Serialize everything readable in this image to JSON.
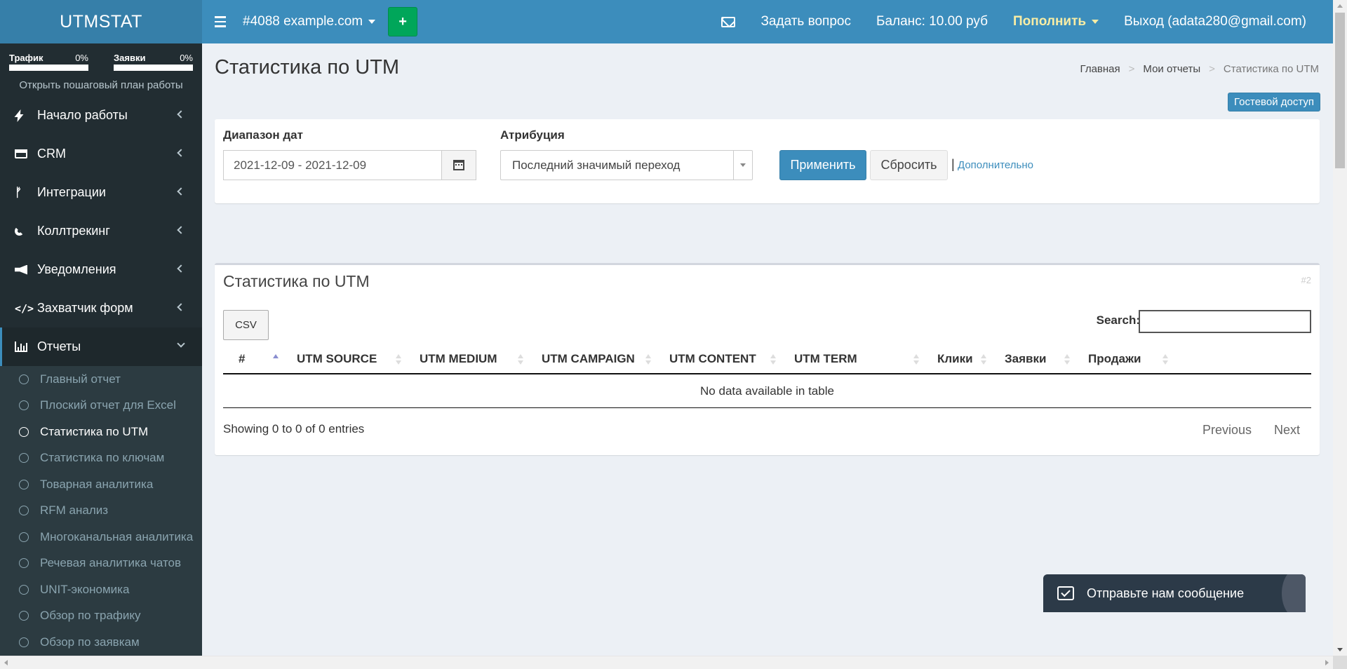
{
  "header": {
    "logo": "UTMSTAT",
    "project": "#4088 example.com",
    "add_label": "+",
    "ask_question": "Задать вопрос",
    "balance": "Баланс: 10.00 руб",
    "topup": "Пополнить",
    "logout": "Выход (adata280@gmail.com)"
  },
  "sidebar": {
    "progress": [
      {
        "label": "Трафик",
        "percent": "0%",
        "value": 0
      },
      {
        "label": "Заявки",
        "percent": "0%",
        "value": 0
      }
    ],
    "plan_link": "Открыть пошаговый план работы",
    "menu": [
      {
        "label": "Начало работы",
        "icon": "bolt-icon"
      },
      {
        "label": "CRM",
        "icon": "cart-icon"
      },
      {
        "label": "Интеграции",
        "icon": "code-fork-icon"
      },
      {
        "label": "Коллтрекинг",
        "icon": "phone-icon"
      },
      {
        "label": "Уведомления",
        "icon": "megaphone-icon"
      },
      {
        "label": "Захватчик форм",
        "icon": "code-icon"
      },
      {
        "label": "Отчеты",
        "icon": "bar-chart-icon"
      }
    ],
    "reports_submenu": [
      "Главный отчет",
      "Плоский отчет для Excel",
      "Статистика по UTM",
      "Статистика по ключам",
      "Товарная аналитика",
      "RFM анализ",
      "Многоканальная аналитика",
      "Речевая аналитика чатов",
      "UNIT-экономика",
      "Обзор по трафику",
      "Обзор по заявкам"
    ],
    "active_submenu": "Статистика по UTM"
  },
  "page": {
    "title": "Статистика по UTM",
    "breadcrumb": [
      "Главная",
      "Мои отчеты",
      "Статистика по UTM"
    ],
    "breadcrumb_sep": ">",
    "guest_access": "Гостевой доступ"
  },
  "filters": {
    "date_label": "Диапазон дат",
    "date_value": "2021-12-09 - 2021-12-09",
    "attribution_label": "Атрибуция",
    "attribution_value": "Последний значимый переход",
    "apply": "Применить",
    "reset": "Сбросить",
    "separator": "|",
    "more": "Дополнительно"
  },
  "table_box": {
    "title": "Статистика по UTM",
    "number": "#2",
    "csv": "CSV",
    "search_label": "Search:",
    "search_value": "",
    "columns": [
      "#",
      "UTM SOURCE",
      "UTM MEDIUM",
      "UTM CAMPAIGN",
      "UTM CONTENT",
      "UTM TERM",
      "Клики",
      "Заявки",
      "Продажи"
    ],
    "empty_text": "No data available in table",
    "showing": "Showing 0 to 0 of 0 entries",
    "previous": "Previous",
    "next": "Next"
  },
  "chat": {
    "label": "Отправьте нам сообщение"
  },
  "colors": {
    "header": "#3c8dbc",
    "logo_bg": "#367fa9",
    "sidebar_bg": "#222d32",
    "add_button": "#00a65a",
    "topup": "#f8eda5"
  }
}
